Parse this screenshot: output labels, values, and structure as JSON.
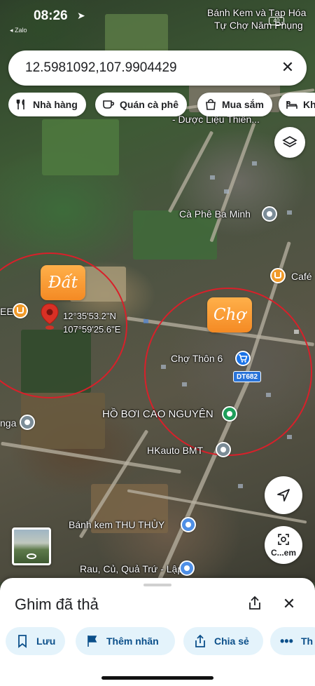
{
  "status_bar": {
    "time": "08:26",
    "back_app": "◂ Zalo",
    "battery": "40"
  },
  "search": {
    "query": "12.5981092,107.9904429"
  },
  "chips": [
    {
      "label": "Nhà hàng",
      "icon": "fork-knife-icon"
    },
    {
      "label": "Quán cà phê",
      "icon": "coffee-icon"
    },
    {
      "label": "Mua sắm",
      "icon": "shopping-bag-icon"
    },
    {
      "label": "Kh",
      "icon": "bed-icon"
    }
  ],
  "map": {
    "tags": {
      "land": "Đất",
      "market": "Chợ"
    },
    "pin_coords": {
      "lat": "12°35'53.2\"N",
      "lon": "107°59'25.6\"E"
    },
    "places": {
      "cake_shop_top": "Bánh Kem và Tạp Hóa",
      "market_top": "Tự Chợ Năm Phụng",
      "medicine": "- Dược Liệu Thiên...",
      "coffee_minh": "Cà Phê Ba Minh",
      "cafe_right": "Café",
      "cafe_left": "EE",
      "cho_thon": "Chợ Thôn 6",
      "route": "DT682",
      "pool": "HỒ BƠI CAO NGUYÊN",
      "hkauto": "HKauto BMT",
      "nga": "nga",
      "thu_thuy": "Bánh kem THU THỦY",
      "rau_cu": "Rau, Củ, Quả Trứ - Lập"
    },
    "lens_label": "C...em"
  },
  "sheet": {
    "title": "Ghim đã thả",
    "actions": [
      {
        "label": "Lưu",
        "icon": "bookmark-icon"
      },
      {
        "label": "Thêm nhãn",
        "icon": "flag-icon"
      },
      {
        "label": "Chia sẻ",
        "icon": "share-icon"
      },
      {
        "label": "Th",
        "icon": "more-icon"
      }
    ]
  },
  "colors": {
    "pin_red": "#d93025",
    "circle_red": "#d8202a",
    "tag_orange": "#f48a24",
    "action_bg": "#e4f3fb",
    "action_text": "#0b4f8a"
  }
}
